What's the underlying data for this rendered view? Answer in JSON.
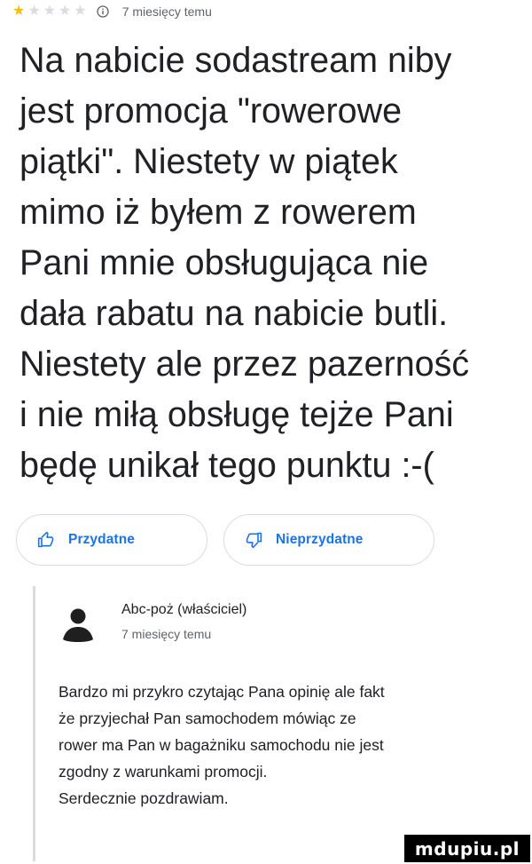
{
  "review": {
    "rating": 1,
    "max_rating": 5,
    "time_ago": "7 miesięcy temu",
    "text_lines": [
      "Na nabicie sodastream niby",
      "jest promocja \"rowerowe",
      "piątki\". Niestety w piątek",
      "mimo iż byłem z rowerem",
      "Pani mnie obsługująca nie",
      "dała rabatu na nabicie butli.",
      "Niestety ale przez pazerność",
      "i nie miłą obsługę tejże Pani",
      "będę unikał tego punktu :-("
    ]
  },
  "votes": {
    "helpful_label": "Przydatne",
    "unhelpful_label": "Nieprzydatne"
  },
  "owner_reply": {
    "name": "Abc-poż (właściciel)",
    "time_ago": "7 miesięcy temu",
    "text_lines": [
      "Bardzo mi przykro czytając Pana opinię ale fakt",
      "że przyjechał Pan samochodem mówiąc ze",
      "rower ma Pan w bagażniku samochodu nie jest",
      "zgodny z warunkami promocji.",
      "Serdecznie pozdrawiam."
    ]
  },
  "watermark": "mdupiu.pl",
  "icons": {
    "star": "star-icon",
    "info": "info-icon",
    "helpful": "thumb-up-icon",
    "unhelpful": "thumb-down-icon",
    "avatar": "person-avatar-icon"
  },
  "colors": {
    "star_filled": "#fbbc04",
    "star_empty": "#dadce0",
    "accent": "#1a73e8",
    "avatar": "#1f1f1f"
  }
}
